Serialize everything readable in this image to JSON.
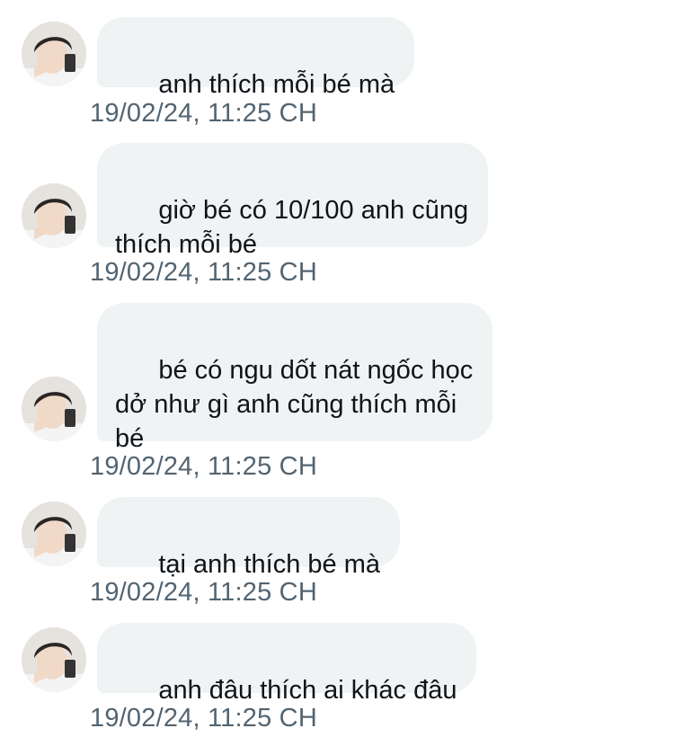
{
  "conversation": {
    "messages": [
      {
        "text": "anh thích mỗi bé mà",
        "timestamp": "19/02/24, 11:25 CH"
      },
      {
        "text": "giờ bé có 10/100 anh cũng\nthích mỗi bé",
        "timestamp": "19/02/24, 11:25 CH"
      },
      {
        "text": "bé có ngu dốt nát ngốc học\ndở như gì anh cũng thích mỗi\nbé",
        "timestamp": "19/02/24, 11:25 CH"
      },
      {
        "text": "tại anh thích bé mà",
        "timestamp": "19/02/24, 11:25 CH"
      },
      {
        "text": "anh đâu thích ai khác đâu",
        "timestamp": "19/02/24, 11:25 CH"
      }
    ]
  },
  "colors": {
    "bubble": "#eff3f4",
    "text": "#0f1419",
    "timestamp": "#536471"
  },
  "icons": {
    "avatar": "profile-photo-avatar"
  }
}
